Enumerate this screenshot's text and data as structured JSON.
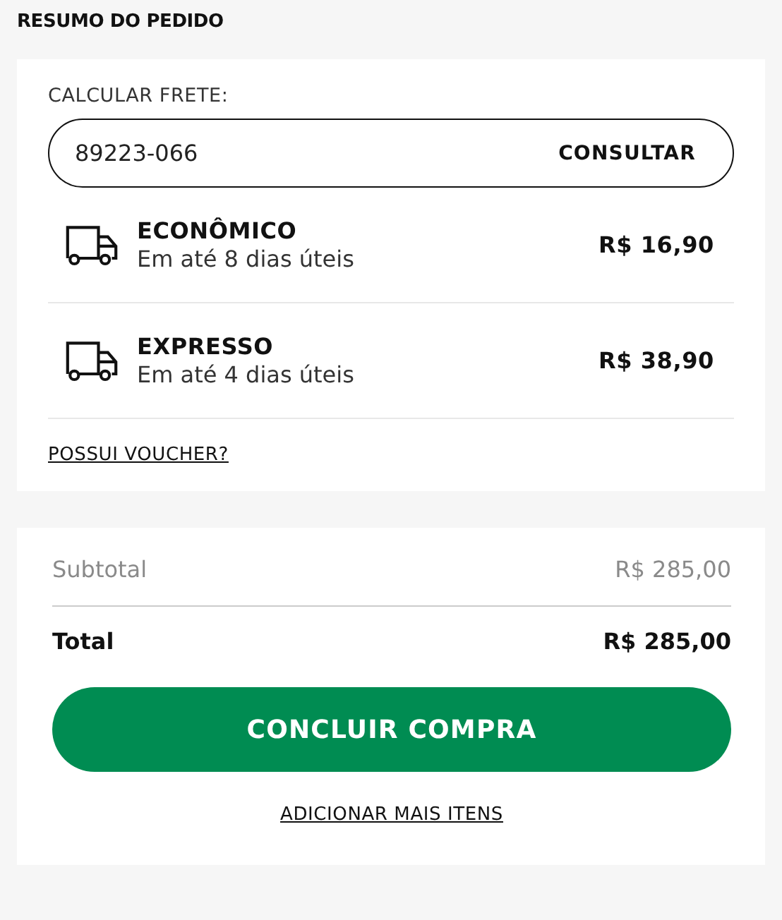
{
  "title": "RESUMO DO PEDIDO",
  "shipping": {
    "label": "CALCULAR FRETE:",
    "zip_value": "89223-066",
    "button": "CONSULTAR",
    "options": [
      {
        "name": "ECONÔMICO",
        "eta": "Em até 8 dias úteis",
        "price": "R$ 16,90"
      },
      {
        "name": "EXPRESSO",
        "eta": "Em até 4 dias úteis",
        "price": "R$ 38,90"
      }
    ],
    "voucher_link": "POSSUI VOUCHER?"
  },
  "totals": {
    "subtotal_label": "Subtotal",
    "subtotal_value": "R$ 285,00",
    "total_label": "Total",
    "total_value": "R$ 285,00"
  },
  "checkout_button": "CONCLUIR COMPRA",
  "add_more_link": "ADICIONAR MAIS ITENS"
}
